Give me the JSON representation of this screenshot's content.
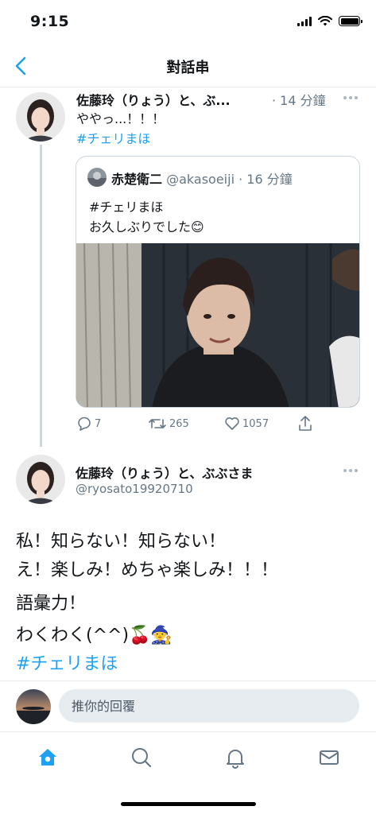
{
  "status_bar": {
    "time": "9:15"
  },
  "header": {
    "title": "對話串"
  },
  "tweet1": {
    "author_name": "佐藤玲（りょう）と、ぶ...",
    "time": "· 14 分鐘",
    "text": "ややっ...！！！",
    "hashtag": "#チェリまほ"
  },
  "quoted": {
    "author_name": "赤楚衛二",
    "handle_time": "@akasoeiji · 16 分鐘",
    "line1": "#チェリまほ",
    "line2": "お久しぶりでした😊"
  },
  "actions": {
    "replies": "7",
    "retweets": "265",
    "likes": "1057"
  },
  "main_tweet": {
    "author_name": "佐藤玲（りょう）と、ぶぶさま",
    "handle": "@ryosato19920710",
    "lines": [
      "私！知らない！知らない！",
      "え！楽しみ！めちゃ楽しみ！！！",
      "語彙力！",
      "わくわく(^^)🍒🧙"
    ],
    "hashtag": "#チェリまほ"
  },
  "reply": {
    "placeholder": "推你的回覆"
  },
  "colors": {
    "accent": "#1da1f2",
    "secondary_text": "#657786",
    "border": "#e6ecf0"
  }
}
